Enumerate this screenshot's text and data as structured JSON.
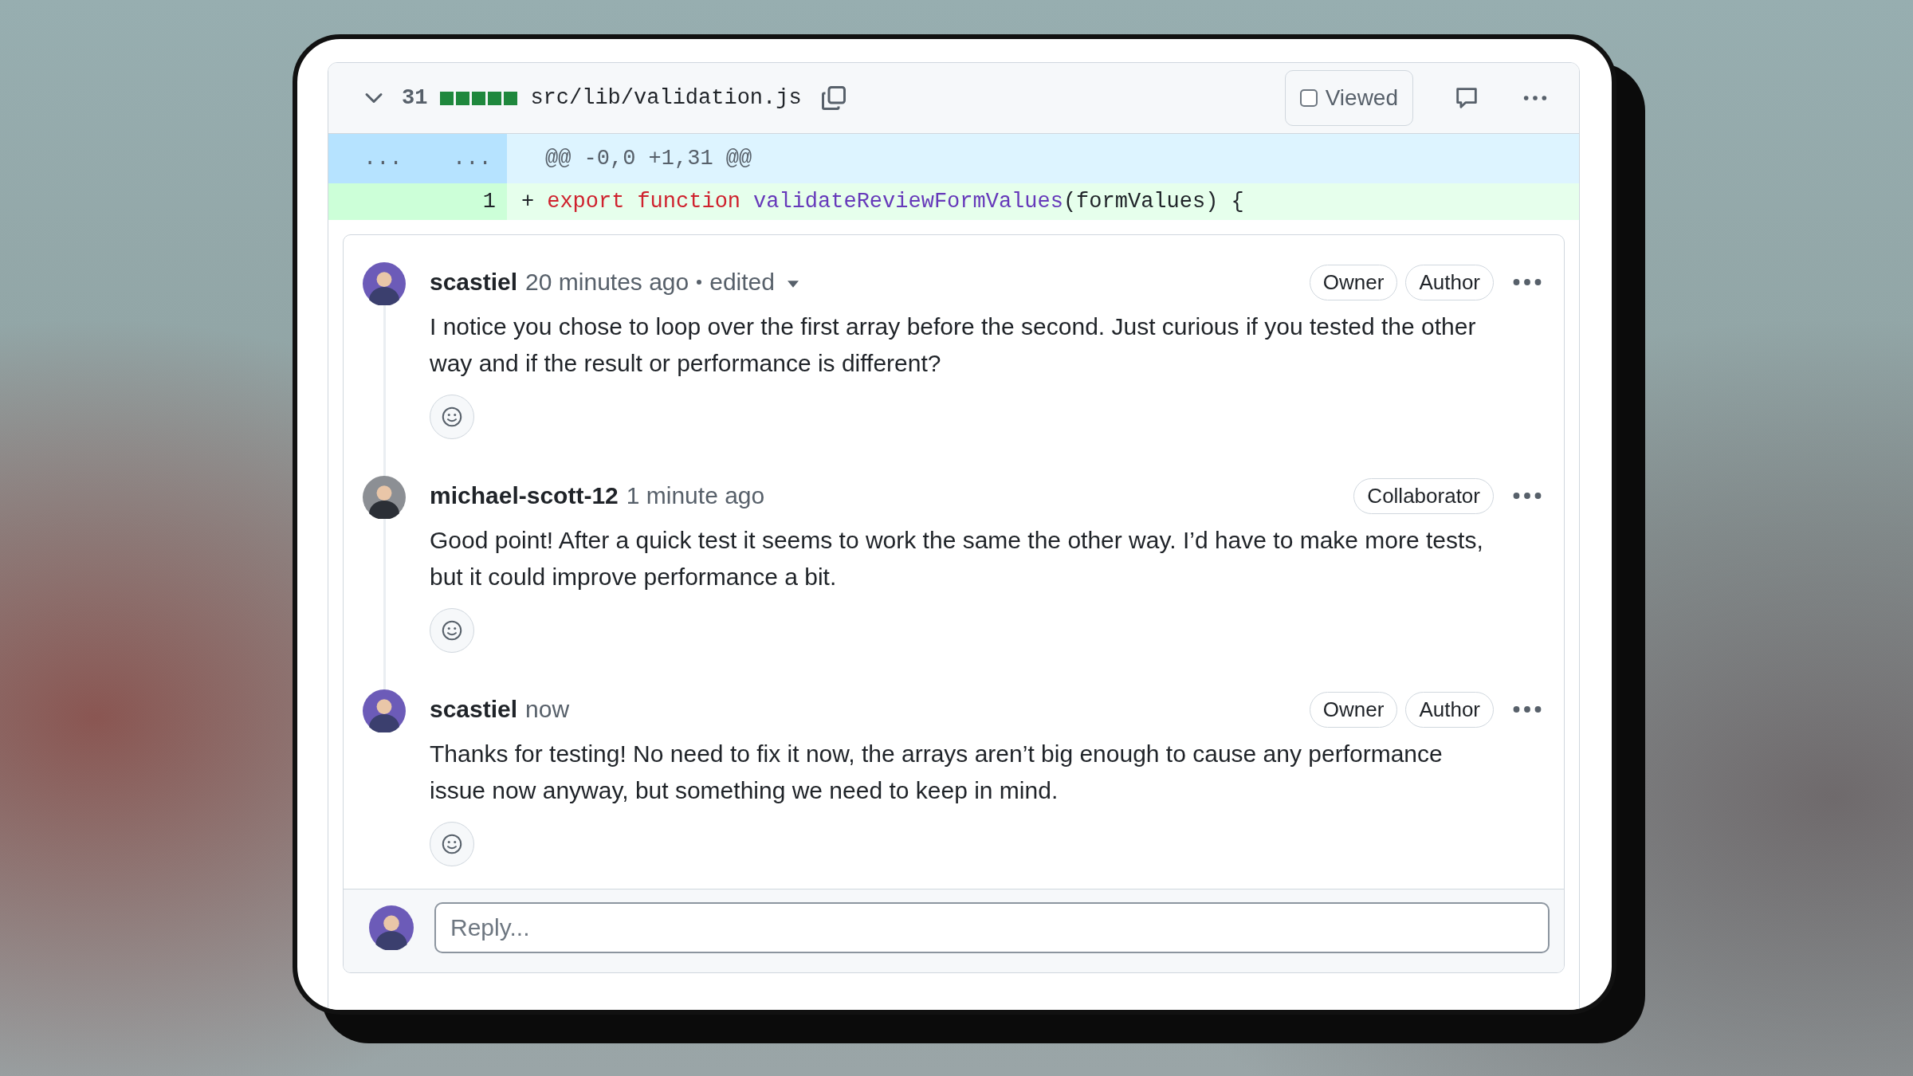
{
  "file": {
    "expanded": true,
    "lines_changed": "31",
    "diffstat": [
      {
        "kind": "added"
      },
      {
        "kind": "added"
      },
      {
        "kind": "added"
      },
      {
        "kind": "added"
      },
      {
        "kind": "added"
      }
    ],
    "path": "src/lib/validation.js",
    "viewed": {
      "label": "Viewed",
      "checked": false
    }
  },
  "hunk": {
    "old_marker": "...",
    "new_marker": "...",
    "header": "@@ -0,0 +1,31 @@"
  },
  "code_line": {
    "new_number": "1",
    "sign": "+",
    "tokens": [
      {
        "kind": "keyword",
        "text": "export"
      },
      {
        "kind": "keyword",
        "text": "function"
      },
      {
        "kind": "entity",
        "text": "validateReviewFormValues"
      },
      {
        "kind": "plain",
        "text": "(formValues) {"
      }
    ]
  },
  "comments": [
    {
      "author": "scastiel",
      "time": "20 minutes ago",
      "edited": "edited",
      "badges": [
        "Owner",
        "Author"
      ],
      "body": "I notice you chose to loop over the first array before the second. Just curious if you tested the other way and if the result or performance is different?"
    },
    {
      "author": "michael-scott-12",
      "time": "1 minute ago",
      "badges": [
        "Collaborator"
      ],
      "body": "Good point! After a quick test it seems to work the same the other way. I’d have to make more tests, but it could improve performance a bit."
    },
    {
      "author": "scastiel",
      "time": "now",
      "badges": [
        "Owner",
        "Author"
      ],
      "body": "Thanks for testing! No need to fix it now, the arrays aren’t big enough to cause any performance issue now anyway, but something we need to keep in mind."
    }
  ],
  "reply": {
    "placeholder": "Reply..."
  }
}
